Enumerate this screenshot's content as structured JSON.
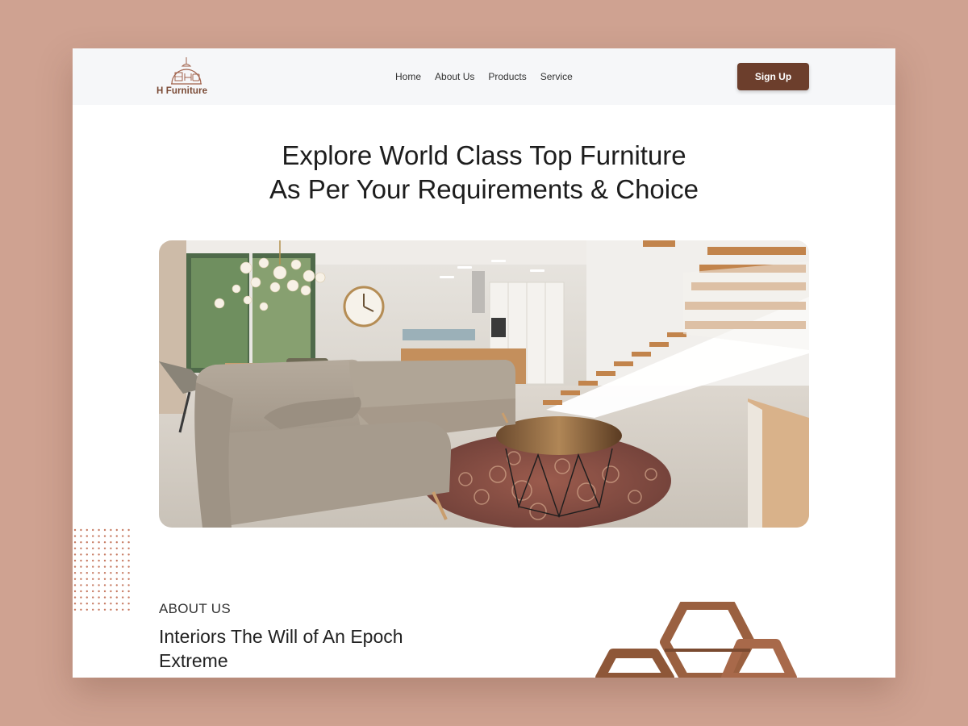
{
  "brand": {
    "name": "H Furniture",
    "color": "#7a4a35"
  },
  "nav": {
    "items": [
      "Home",
      "About Us",
      "Products",
      "Service"
    ]
  },
  "signup": {
    "label": "Sign Up",
    "color": "#6c3e2c"
  },
  "hero": {
    "title_line1": "Explore World Class Top Furniture",
    "title_line2": "As Per Your Requirements & Choice"
  },
  "about": {
    "eyebrow": "ABOUT US",
    "title_line1": "Interiors The Will of An Epoch",
    "title_line2": "Extreme"
  },
  "colors": {
    "background": "#cfa291",
    "navbar": "#f6f7f9",
    "accent": "#6c3e2c"
  }
}
